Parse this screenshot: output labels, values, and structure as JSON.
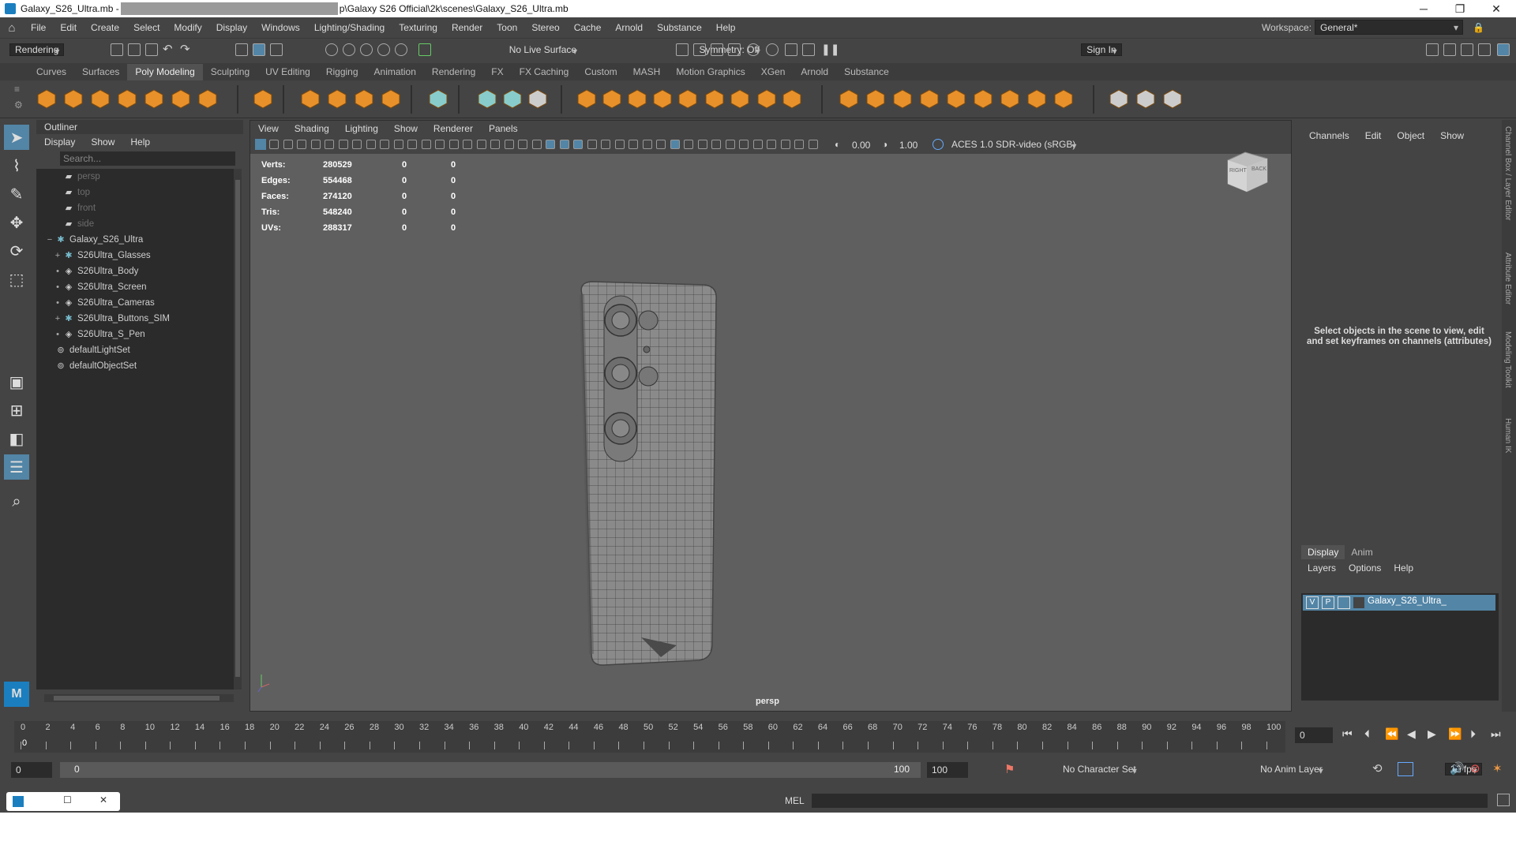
{
  "title": {
    "file": "Galaxy_S26_Ultra.mb - ",
    "path_tail": "p\\Galaxy S26 Official\\2k\\scenes\\Galaxy_S26_Ultra.mb",
    "controls": [
      "─",
      "❐",
      "✕"
    ]
  },
  "menubar": [
    "File",
    "Edit",
    "Create",
    "Select",
    "Modify",
    "Display",
    "Windows",
    "Lighting/Shading",
    "Texturing",
    "Render",
    "Toon",
    "Stereo",
    "Cache",
    "Arnold",
    "Substance",
    "Help"
  ],
  "workspace": {
    "label": "Workspace:",
    "value": "General*"
  },
  "statusline": {
    "menuset": "Rendering",
    "live_surface": "No Live Surface",
    "symmetry": "Symmetry: Off",
    "sign_in": "Sign In"
  },
  "shelf_tabs": [
    "Curves",
    "Surfaces",
    "Poly Modeling",
    "Sculpting",
    "UV Editing",
    "Rigging",
    "Animation",
    "Rendering",
    "FX",
    "FX Caching",
    "Custom",
    "MASH",
    "Motion Graphics",
    "XGen",
    "Arnold",
    "Substance"
  ],
  "shelf_active": "Poly Modeling",
  "outliner": {
    "title": "Outliner",
    "menu": [
      "Display",
      "Show",
      "Help"
    ],
    "search_placeholder": "Search...",
    "items": [
      {
        "label": "persp",
        "dim": true,
        "indent": 1,
        "icon": "camera-icon"
      },
      {
        "label": "top",
        "dim": true,
        "indent": 1,
        "icon": "camera-icon"
      },
      {
        "label": "front",
        "dim": true,
        "indent": 1,
        "icon": "camera-icon"
      },
      {
        "label": "side",
        "dim": true,
        "indent": 1,
        "icon": "camera-icon"
      },
      {
        "label": "Galaxy_S26_Ultra",
        "dim": false,
        "indent": 0,
        "icon": "group-icon",
        "expander": "−"
      },
      {
        "label": "S26Ultra_Glasses",
        "dim": false,
        "indent": 1,
        "icon": "group-icon",
        "expander": "+"
      },
      {
        "label": "S26Ultra_Body",
        "dim": false,
        "indent": 1,
        "icon": "mesh-icon",
        "expander": "•"
      },
      {
        "label": "S26Ultra_Screen",
        "dim": false,
        "indent": 1,
        "icon": "mesh-icon",
        "expander": "•"
      },
      {
        "label": "S26Ultra_Cameras",
        "dim": false,
        "indent": 1,
        "icon": "mesh-icon",
        "expander": "•"
      },
      {
        "label": "S26Ultra_Buttons_SIM",
        "dim": false,
        "indent": 1,
        "icon": "group-icon",
        "expander": "+"
      },
      {
        "label": "S26Ultra_S_Pen",
        "dim": false,
        "indent": 1,
        "icon": "mesh-icon",
        "expander": "•"
      },
      {
        "label": "defaultLightSet",
        "dim": false,
        "indent": 0,
        "icon": "set-icon"
      },
      {
        "label": "defaultObjectSet",
        "dim": false,
        "indent": 0,
        "icon": "set-icon"
      }
    ]
  },
  "viewport": {
    "menu": [
      "View",
      "Shading",
      "Lighting",
      "Show",
      "Renderer",
      "Panels"
    ],
    "exposure": "0.00",
    "gamma": "1.00",
    "color_space": "ACES 1.0 SDR-video (sRGB)",
    "camera": "persp",
    "viewcube": {
      "right": "RIGHT",
      "back": "BACK"
    },
    "hud": [
      {
        "label": "Verts:",
        "a": "280529",
        "b": "0",
        "c": "0"
      },
      {
        "label": "Edges:",
        "a": "554468",
        "b": "0",
        "c": "0"
      },
      {
        "label": "Faces:",
        "a": "274120",
        "b": "0",
        "c": "0"
      },
      {
        "label": "Tris:",
        "a": "548240",
        "b": "0",
        "c": "0"
      },
      {
        "label": "UVs:",
        "a": "288317",
        "b": "0",
        "c": "0"
      }
    ]
  },
  "channelbox": {
    "menu": [
      "Channels",
      "Edit",
      "Object",
      "Show"
    ],
    "message": "Select objects in the scene to view, edit and set keyframes on channels (attributes)",
    "layer_tabs": [
      "Display",
      "Anim"
    ],
    "layer_menu": [
      "Layers",
      "Options",
      "Help"
    ],
    "layer": {
      "v": "V",
      "p": "P",
      "name": "Galaxy_S26_Ultra_"
    }
  },
  "side_tabs": [
    "Channel Box / Layer Editor",
    "Attribute Editor",
    "Modeling Toolkit",
    "Human IK"
  ],
  "timeline": {
    "ticks": [
      "0",
      "2",
      "4",
      "6",
      "8",
      "10",
      "12",
      "14",
      "16",
      "18",
      "20",
      "22",
      "24",
      "26",
      "28",
      "30",
      "32",
      "34",
      "36",
      "38",
      "40",
      "42",
      "44",
      "46",
      "48",
      "50",
      "52",
      "54",
      "56",
      "58",
      "60",
      "62",
      "64",
      "66",
      "68",
      "70",
      "72",
      "74",
      "76",
      "78",
      "80",
      "82",
      "84",
      "86",
      "88",
      "90",
      "92",
      "94",
      "96",
      "98",
      "100"
    ],
    "current_frame": "0",
    "current_field": "0"
  },
  "range": {
    "start": "0",
    "inner_start": "0",
    "inner_end": "100",
    "end": "100",
    "character_set": "No Character Set",
    "anim_layer": "No Anim Layer",
    "fps": "30 fps"
  },
  "cmdline": {
    "label": "MEL"
  }
}
